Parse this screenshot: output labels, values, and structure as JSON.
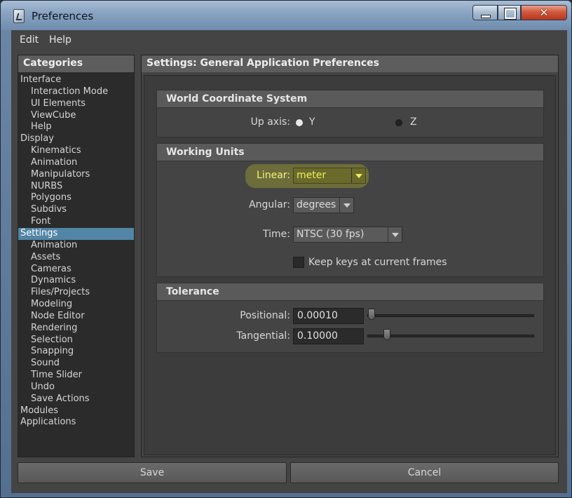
{
  "window": {
    "title": "Preferences"
  },
  "menu": {
    "edit": "Edit",
    "help": "Help"
  },
  "categories": {
    "header": "Categories",
    "items": [
      {
        "label": "Interface",
        "indent": false,
        "selected": false
      },
      {
        "label": "Interaction Mode",
        "indent": true,
        "selected": false
      },
      {
        "label": "UI Elements",
        "indent": true,
        "selected": false
      },
      {
        "label": "ViewCube",
        "indent": true,
        "selected": false
      },
      {
        "label": "Help",
        "indent": true,
        "selected": false
      },
      {
        "label": "Display",
        "indent": false,
        "selected": false
      },
      {
        "label": "Kinematics",
        "indent": true,
        "selected": false
      },
      {
        "label": "Animation",
        "indent": true,
        "selected": false
      },
      {
        "label": "Manipulators",
        "indent": true,
        "selected": false
      },
      {
        "label": "NURBS",
        "indent": true,
        "selected": false
      },
      {
        "label": "Polygons",
        "indent": true,
        "selected": false
      },
      {
        "label": "Subdivs",
        "indent": true,
        "selected": false
      },
      {
        "label": "Font",
        "indent": true,
        "selected": false
      },
      {
        "label": "Settings",
        "indent": false,
        "selected": true
      },
      {
        "label": "Animation",
        "indent": true,
        "selected": false
      },
      {
        "label": "Assets",
        "indent": true,
        "selected": false
      },
      {
        "label": "Cameras",
        "indent": true,
        "selected": false
      },
      {
        "label": "Dynamics",
        "indent": true,
        "selected": false
      },
      {
        "label": "Files/Projects",
        "indent": true,
        "selected": false
      },
      {
        "label": "Modeling",
        "indent": true,
        "selected": false
      },
      {
        "label": "Node Editor",
        "indent": true,
        "selected": false
      },
      {
        "label": "Rendering",
        "indent": true,
        "selected": false
      },
      {
        "label": "Selection",
        "indent": true,
        "selected": false
      },
      {
        "label": "Snapping",
        "indent": true,
        "selected": false
      },
      {
        "label": "Sound",
        "indent": true,
        "selected": false
      },
      {
        "label": "Time Slider",
        "indent": true,
        "selected": false
      },
      {
        "label": "Undo",
        "indent": true,
        "selected": false
      },
      {
        "label": "Save Actions",
        "indent": true,
        "selected": false
      },
      {
        "label": "Modules",
        "indent": false,
        "selected": false
      },
      {
        "label": "Applications",
        "indent": false,
        "selected": false
      }
    ]
  },
  "settings": {
    "header": "Settings: General Application Preferences",
    "world": {
      "title": "World Coordinate System",
      "up_axis_label": "Up axis:",
      "y_label": "Y",
      "z_label": "Z",
      "selected_axis": "Y"
    },
    "units": {
      "title": "Working Units",
      "linear_label": "Linear:",
      "linear_value": "meter",
      "angular_label": "Angular:",
      "angular_value": "degrees",
      "time_label": "Time:",
      "time_value": "NTSC (30 fps)",
      "keep_keys_label": "Keep keys at current frames",
      "keep_keys_checked": false
    },
    "tolerance": {
      "title": "Tolerance",
      "positional_label": "Positional:",
      "positional_value": "0.00010",
      "tangential_label": "Tangential:",
      "tangential_value": "0.10000"
    }
  },
  "buttons": {
    "save": "Save",
    "cancel": "Cancel"
  },
  "colors": {
    "selection": "#5285a6",
    "highlight": "#d6d628"
  }
}
